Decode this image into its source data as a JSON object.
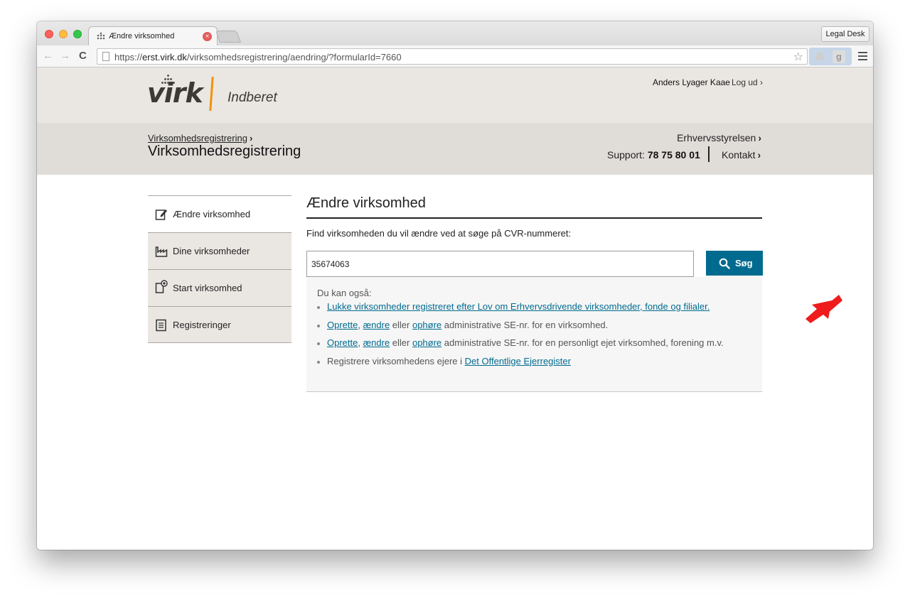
{
  "browser": {
    "tab_title": "Ændre virksomhed",
    "tab_close_icon": "close-icon",
    "extension_button": "Legal Desk",
    "url_prefix": "https://",
    "url_host": "erst.virk.dk",
    "url_path": "/virksomhedsregistrering/aendring/?formularId=7660"
  },
  "header": {
    "logo_text": "virk",
    "logo_sub": "Indberet",
    "user_name": "Anders Lyager Kaae",
    "logout": "Log ud ›",
    "breadcrumb": "Virksomhedsregistrering",
    "section_title": "Virksomhedsregistrering",
    "agency": "Erhvervsstyrelsen",
    "support_label": "Support:",
    "support_phone": "78 75 80 01",
    "contact": "Kontakt"
  },
  "sidebar": {
    "items": [
      {
        "label": "Ændre virksomhed",
        "icon": "edit-icon",
        "active": true
      },
      {
        "label": "Dine virksomheder",
        "icon": "factory-icon",
        "active": false
      },
      {
        "label": "Start virksomhed",
        "icon": "new-document-icon",
        "active": false
      },
      {
        "label": "Registreringer",
        "icon": "list-icon",
        "active": false
      }
    ]
  },
  "main": {
    "title": "Ændre virksomhed",
    "instruction": "Find virksomheden du vil ændre ved at søge på CVR-nummeret:",
    "cvr_value": "35674063",
    "search_label": "Søg",
    "options_heading": "Du kan også:",
    "option1_link": "Lukke virksomheder registreret efter Lov om Erhvervsdrivende virksomheder, fonde og filialer.",
    "option2": {
      "a": "Oprette",
      "sep1": ", ",
      "b": "ændre",
      "sep2": " eller ",
      "c": "ophøre",
      "rest": " administrative SE-nr. for en virksomhed."
    },
    "option3": {
      "a": "Oprette",
      "sep1": ", ",
      "b": "ændre",
      "sep2": " eller ",
      "c": "ophøre",
      "rest": " administrative SE-nr. for en personligt ejet virksomhed, forening m.v."
    },
    "option4": {
      "text": "Registrere virksomhedens ejere i ",
      "link": "Det Offentlige Ejerregister"
    }
  },
  "colors": {
    "accent": "#006b8f",
    "brand_orange": "#f39200",
    "arrow": "#ee1c1c"
  }
}
